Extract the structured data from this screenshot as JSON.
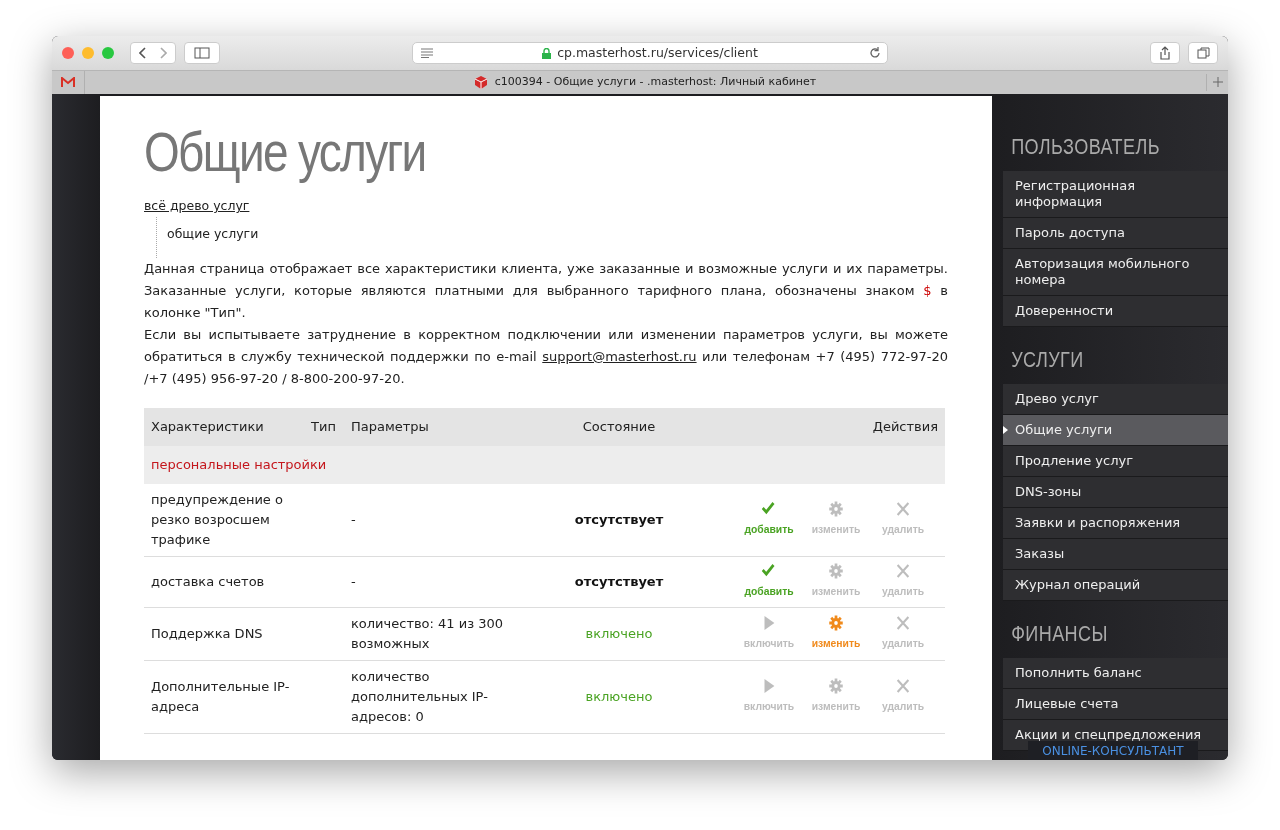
{
  "browser": {
    "url": "cp.masterhost.ru/services/client",
    "tab_title": "c100394 - Общие услуги - .masterhost: Личный кабинет"
  },
  "page": {
    "title": "Общие услуги",
    "breadcrumb": "всё древо услуг",
    "tree_item": "общие услуги",
    "description": [
      {
        "parts": [
          {
            "kind": "text",
            "text": "Данная страница отображает все характеристики клиента, уже заказанные и возможные услуги и их параметры. Заказанные услуги, которые являются платными для выбранного тарифного плана, обозначены знаком "
          },
          {
            "kind": "sign",
            "text": "$"
          },
          {
            "kind": "text",
            "text": " в колонке \"Тип\"."
          }
        ]
      },
      {
        "parts": [
          {
            "kind": "text",
            "text": "Если вы испытываете затруднение в корректном подключении или изменении параметров услуги, вы можете обратиться в службу технической поддержки по e-mail "
          },
          {
            "kind": "link",
            "text": "support@masterhost.ru"
          },
          {
            "kind": "text",
            "text": " или телефонам +7 (495) 772-97-20 /+7 (495) 956-97-20 / 8-800-200-97-20."
          }
        ]
      }
    ]
  },
  "table": {
    "columns": [
      "Характеристики",
      "Тип",
      "Параметры",
      "Состояние",
      "Действия"
    ],
    "group": "персональные настройки",
    "rows": [
      {
        "name": "предупреждение о резко возросшем трафике",
        "params": "-",
        "status": "отсутствует",
        "on": false,
        "actions": [
          {
            "kind": "add",
            "label": "добавить",
            "enabled": true
          },
          {
            "kind": "edit",
            "label": "изменить",
            "enabled": false
          },
          {
            "kind": "delete",
            "label": "удалить",
            "enabled": false
          }
        ]
      },
      {
        "name": "доставка счетов",
        "params": "-",
        "status": "отсутствует",
        "on": false,
        "actions": [
          {
            "kind": "add",
            "label": "добавить",
            "enabled": true
          },
          {
            "kind": "edit",
            "label": "изменить",
            "enabled": false
          },
          {
            "kind": "delete",
            "label": "удалить",
            "enabled": false
          }
        ]
      },
      {
        "name": "Поддержка DNS",
        "params": "количество: 41 из 300 возможных",
        "status": "включено",
        "on": true,
        "actions": [
          {
            "kind": "enable",
            "label": "включить",
            "enabled": false
          },
          {
            "kind": "edit",
            "label": "изменить",
            "enabled": true
          },
          {
            "kind": "delete",
            "label": "удалить",
            "enabled": false
          }
        ]
      },
      {
        "name": "Дополнительные IP-адреса",
        "params": "количество дополнительных IP-адресов: 0",
        "status": "включено",
        "on": true,
        "actions": [
          {
            "kind": "enable",
            "label": "включить",
            "enabled": false
          },
          {
            "kind": "edit",
            "label": "изменить",
            "enabled": false
          },
          {
            "kind": "delete",
            "label": "удалить",
            "enabled": false
          }
        ]
      }
    ]
  },
  "sidebar": [
    {
      "heading": "ПОЛЬЗОВАТЕЛЬ",
      "items": [
        {
          "label": "Регистрационная информация",
          "selected": false
        },
        {
          "label": "Пароль доступа",
          "selected": false
        },
        {
          "label": "Авторизация мобильного номера",
          "selected": false
        },
        {
          "label": "Доверенности",
          "selected": false
        }
      ]
    },
    {
      "heading": "УСЛУГИ",
      "items": [
        {
          "label": "Древо услуг",
          "selected": false
        },
        {
          "label": "Общие услуги",
          "selected": true
        },
        {
          "label": "Продление услуг",
          "selected": false
        },
        {
          "label": "DNS-зоны",
          "selected": false
        },
        {
          "label": "Заявки и распоряжения",
          "selected": false
        },
        {
          "label": "Заказы",
          "selected": false
        },
        {
          "label": "Журнал операций",
          "selected": false
        }
      ]
    },
    {
      "heading": "ФИНАНСЫ",
      "items": [
        {
          "label": "Пополнить баланс",
          "selected": false
        },
        {
          "label": "Лицевые счета",
          "selected": false
        },
        {
          "label": "Акции и спецпредложения",
          "selected": false
        }
      ]
    }
  ],
  "consultant": "ONLINE-КОНСУЛЬТАНТ"
}
